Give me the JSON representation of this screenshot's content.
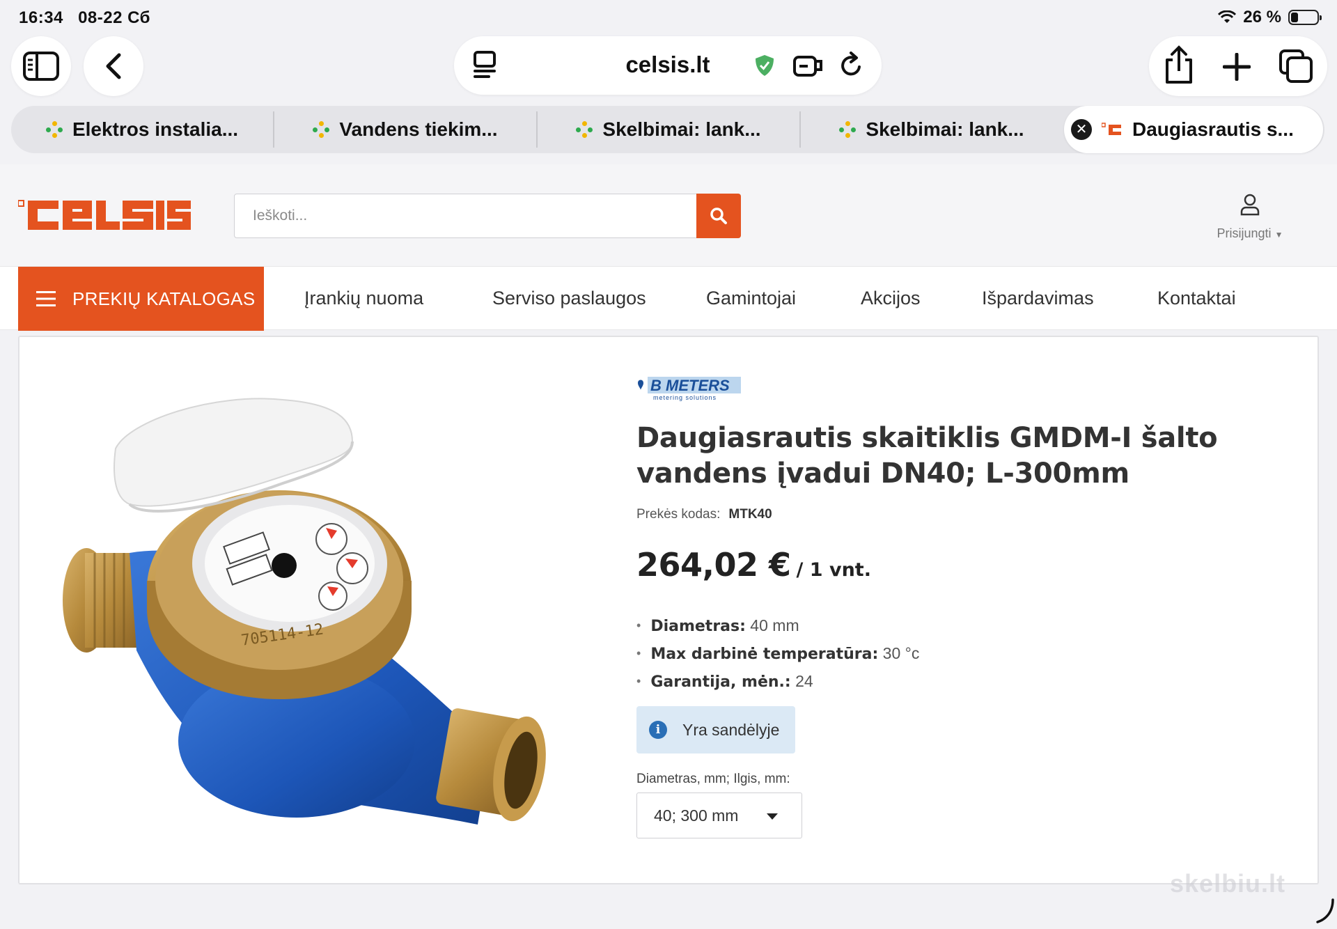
{
  "status_bar": {
    "time": "16:34",
    "date": "08-22 Сб",
    "battery": "26 %"
  },
  "browser": {
    "url": "celsis.lt",
    "tabs": [
      {
        "title": "Elektros instalia..."
      },
      {
        "title": "Vandens tiekim..."
      },
      {
        "title": "Skelbimai: lank..."
      },
      {
        "title": "Skelbimai: lank..."
      },
      {
        "title": "Daugiasrautis s..."
      }
    ]
  },
  "site": {
    "search_placeholder": "Ieškoti...",
    "login_label": "Prisijungti",
    "catalog_label": "PREKIŲ KATALOGAS",
    "nav": [
      "Įrankių nuoma",
      "Serviso paslaugos",
      "Gamintojai",
      "Akcijos",
      "Išpardavimas",
      "Kontaktai"
    ]
  },
  "product": {
    "brand": "B METERS",
    "brand_tagline": "metering solutions",
    "title": "Daugiasrautis skaitiklis GMDM-I šalto vandens įvadui DN40; L-300mm",
    "sku_label": "Prekės kodas:",
    "sku": "MTK40",
    "price": "264,02 €",
    "price_unit": "/ 1 vnt.",
    "specs": [
      {
        "label": "Diametras:",
        "value": " 40 mm"
      },
      {
        "label": "Max darbinė temperatūra:",
        "value": " 30 °c"
      },
      {
        "label": "Garantija, mėn.:",
        "value": " 24"
      }
    ],
    "stock_status": "Yra sandėlyje",
    "variant_label": "Diametras, mm; Ilgis, mm:",
    "variant_value": "40; 300 mm",
    "meter_serial": "705114-12"
  },
  "watermark": "skelbiu.lt",
  "colors": {
    "accent": "#e4531f",
    "stock_bg": "#dbe9f5",
    "info": "#2a6fb6"
  }
}
